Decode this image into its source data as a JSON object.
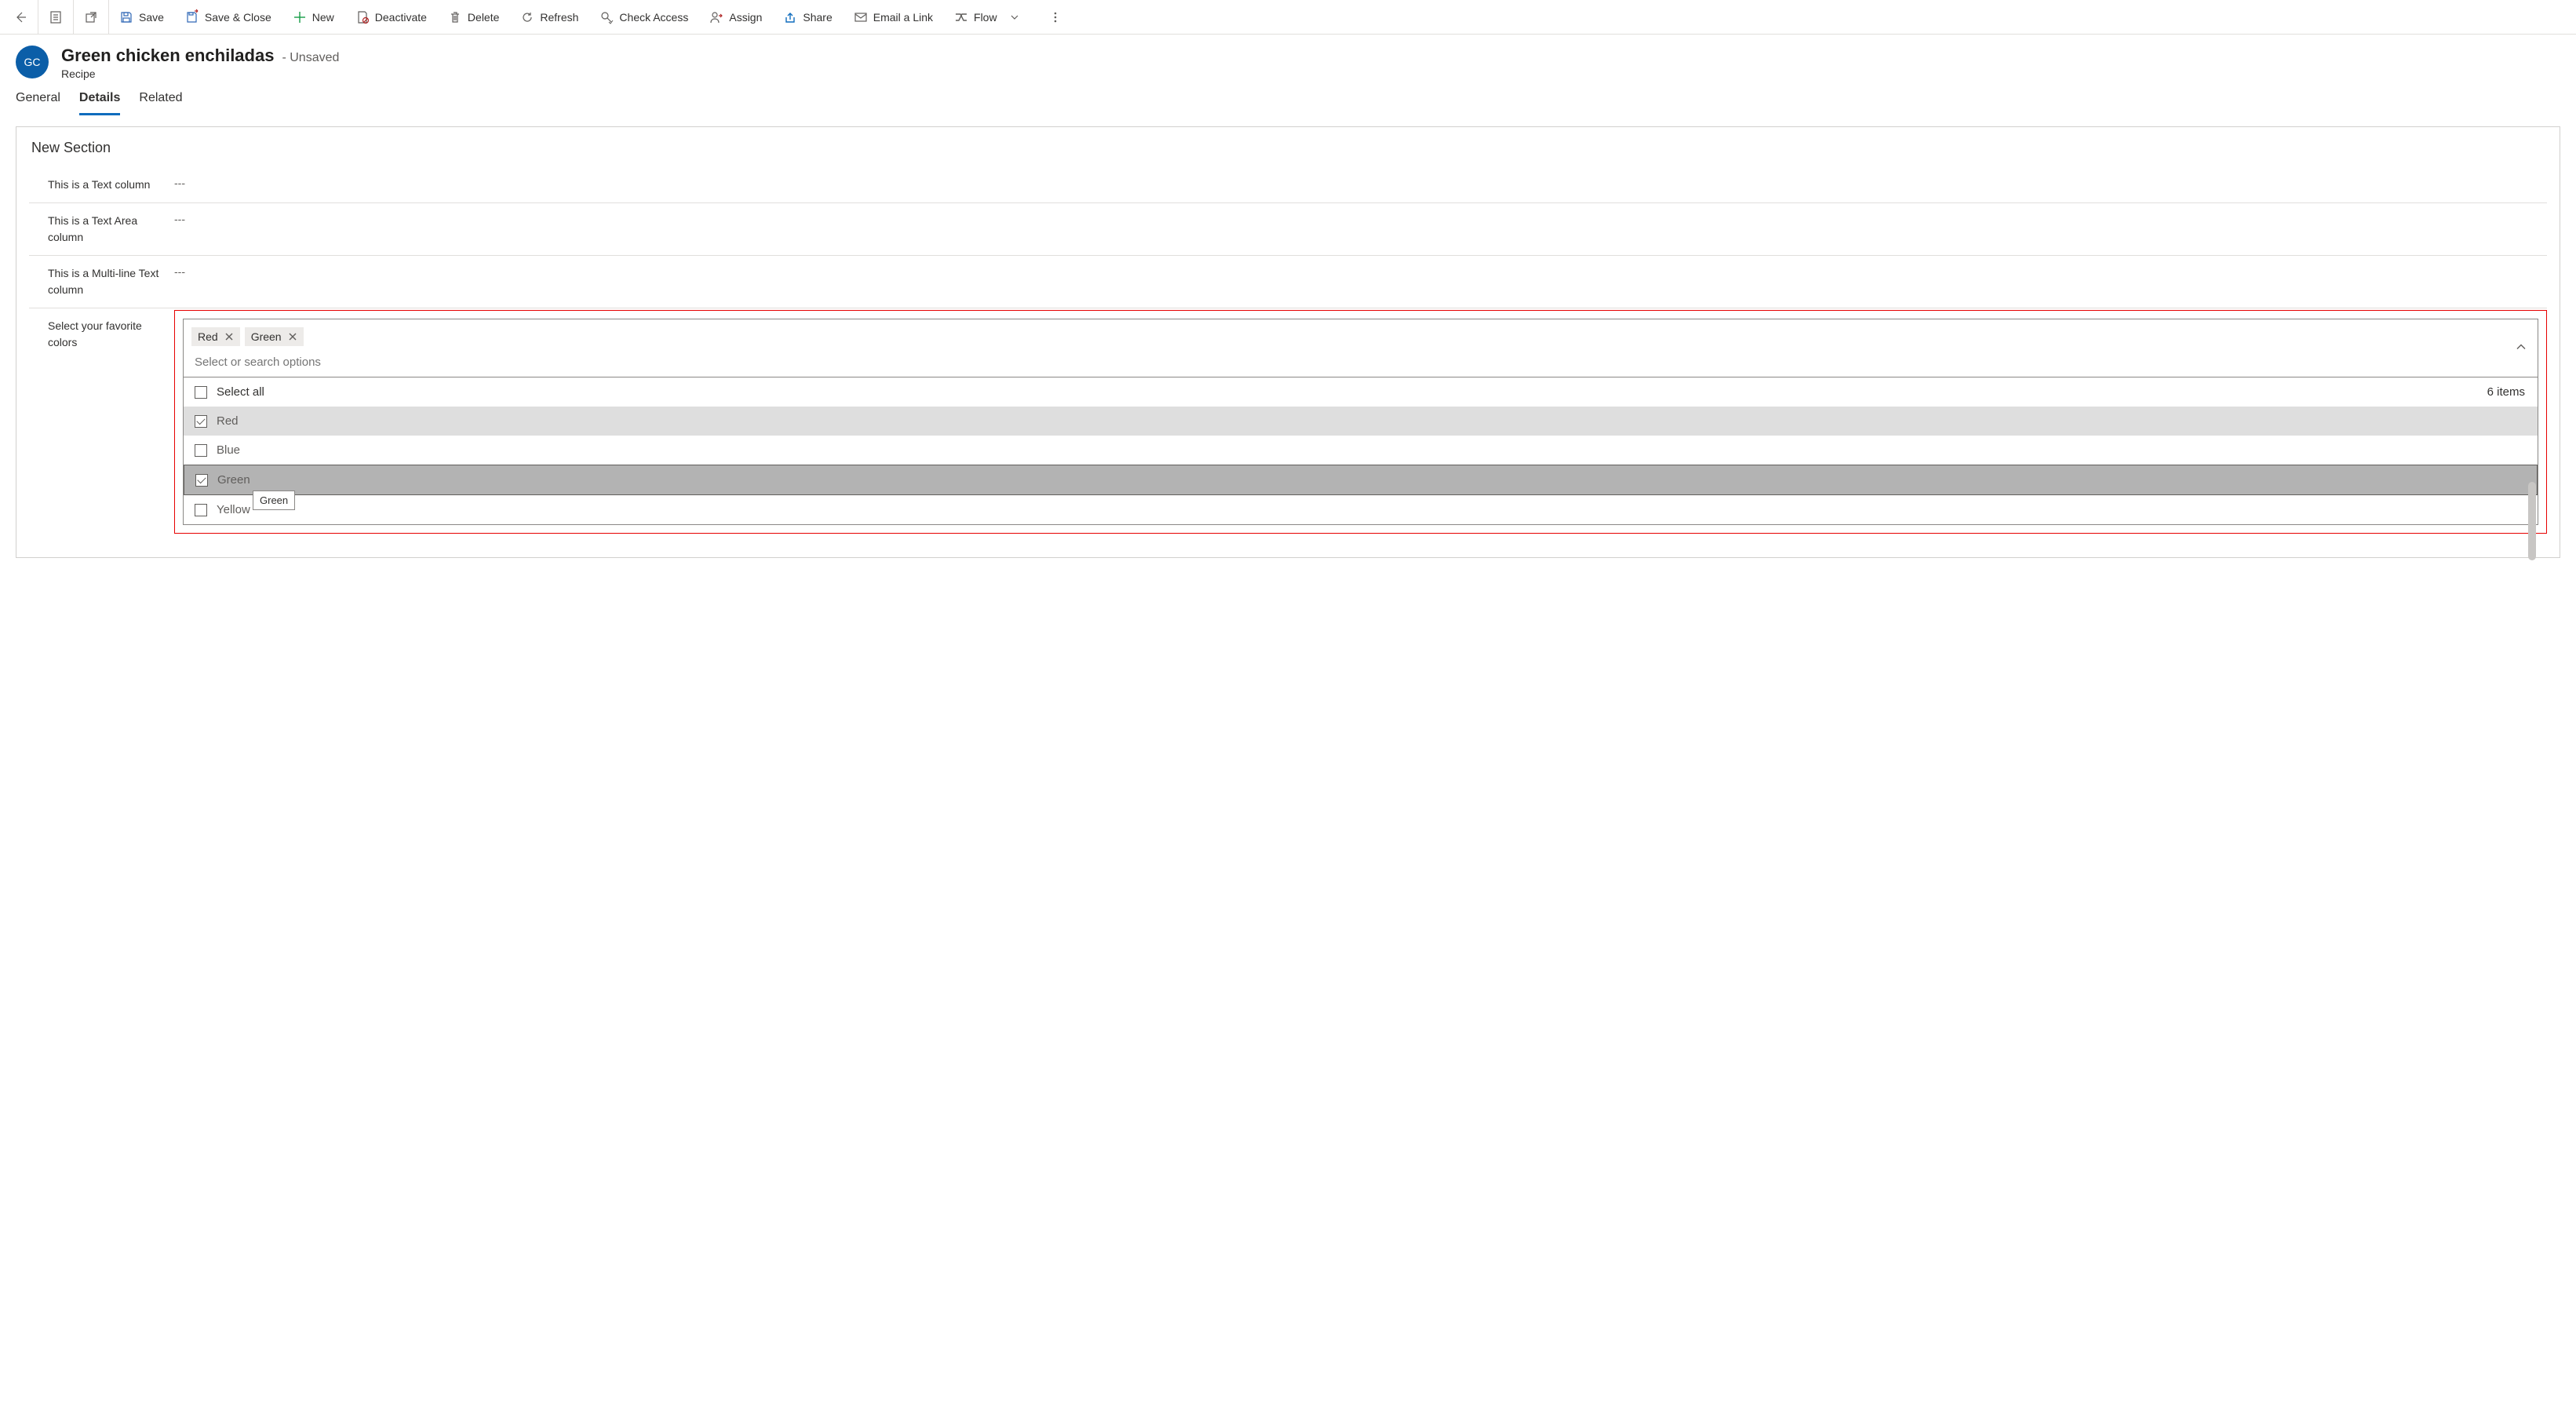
{
  "toolbar": {
    "save": "Save",
    "save_close": "Save & Close",
    "new": "New",
    "deactivate": "Deactivate",
    "delete": "Delete",
    "refresh": "Refresh",
    "check_access": "Check Access",
    "assign": "Assign",
    "share": "Share",
    "email_link": "Email a Link",
    "flow": "Flow"
  },
  "header": {
    "avatar_initials": "GC",
    "title": "Green chicken enchiladas",
    "status": "- Unsaved",
    "subtitle": "Recipe"
  },
  "tabs": {
    "general": "General",
    "details": "Details",
    "related": "Related"
  },
  "section": {
    "title": "New Section",
    "fields": {
      "text_label": "This is a Text column",
      "text_value": "---",
      "textarea_label": "This is a Text Area column",
      "textarea_value": "---",
      "multiline_label": "This is a Multi-line Text column",
      "multiline_value": "---",
      "colors_label": "Select your favorite colors"
    }
  },
  "multiselect": {
    "chips": {
      "0": "Red",
      "1": "Green"
    },
    "search_placeholder": "Select or search options",
    "select_all": "Select all",
    "count_text": "6 items",
    "options": {
      "0": {
        "label": "Red"
      },
      "1": {
        "label": "Blue"
      },
      "2": {
        "label": "Green"
      },
      "3": {
        "label": "Yellow"
      }
    },
    "tooltip": "Green"
  }
}
